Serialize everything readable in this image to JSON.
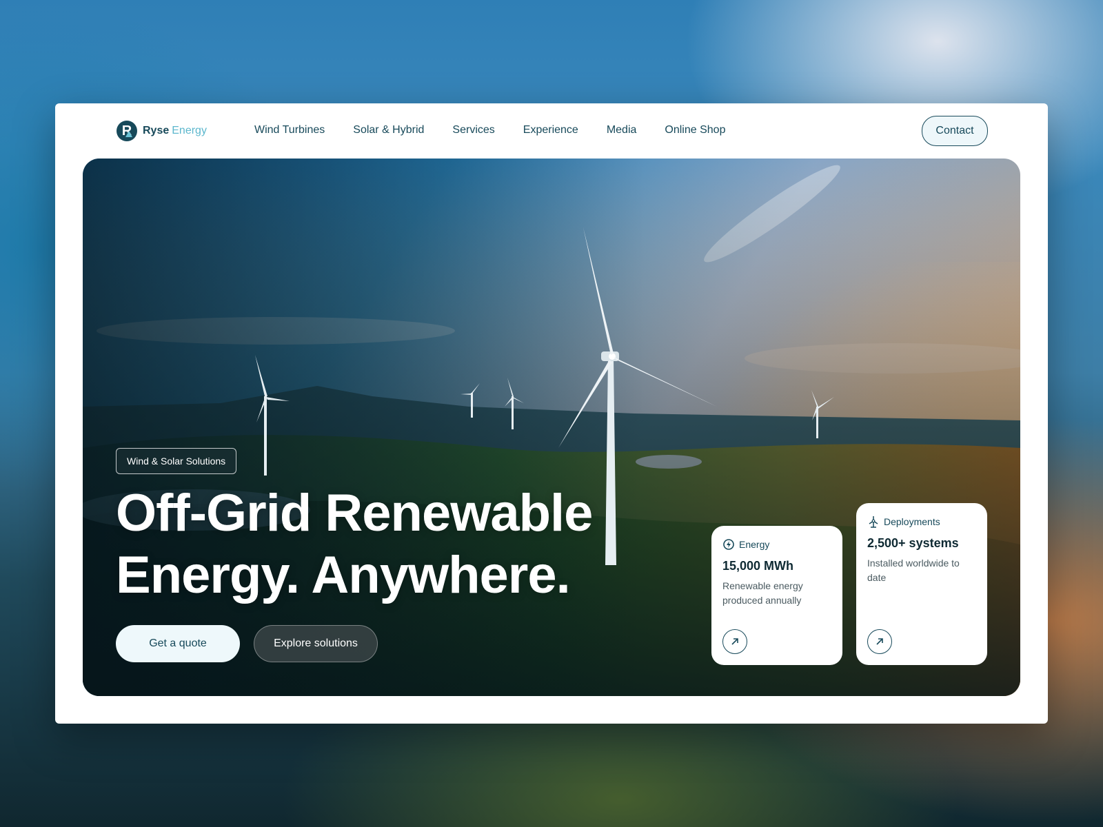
{
  "brand": {
    "name_primary": "Ryse",
    "name_secondary": "Energy",
    "logo_letter": "R"
  },
  "nav": {
    "items": [
      {
        "label": "Wind Turbines"
      },
      {
        "label": "Solar & Hybrid"
      },
      {
        "label": "Services"
      },
      {
        "label": "Experience"
      },
      {
        "label": "Media"
      },
      {
        "label": "Online Shop"
      }
    ],
    "contact_label": "Contact"
  },
  "hero": {
    "tag": "Wind & Solar Solutions",
    "headline_line1": "Off-Grid Renewable",
    "headline_line2": "Energy. Anywhere.",
    "primary_cta": "Get a quote",
    "secondary_cta": "Explore solutions"
  },
  "cards": [
    {
      "title": "Energy",
      "icon": "energy-icon",
      "value": "15,000 MWh",
      "description": "Renewable energy produced annually",
      "arrow_icon": "arrow-up-right-icon"
    },
    {
      "title": "Deployments",
      "icon": "wind-turbine-icon",
      "value": "2,500+ systems",
      "description": "Installed worldwide to date",
      "arrow_icon": "arrow-up-right-icon"
    }
  ],
  "colors": {
    "brand_dark": "#17495a",
    "brand_light": "#5cb7cd",
    "button_light": "#eef8fb"
  }
}
